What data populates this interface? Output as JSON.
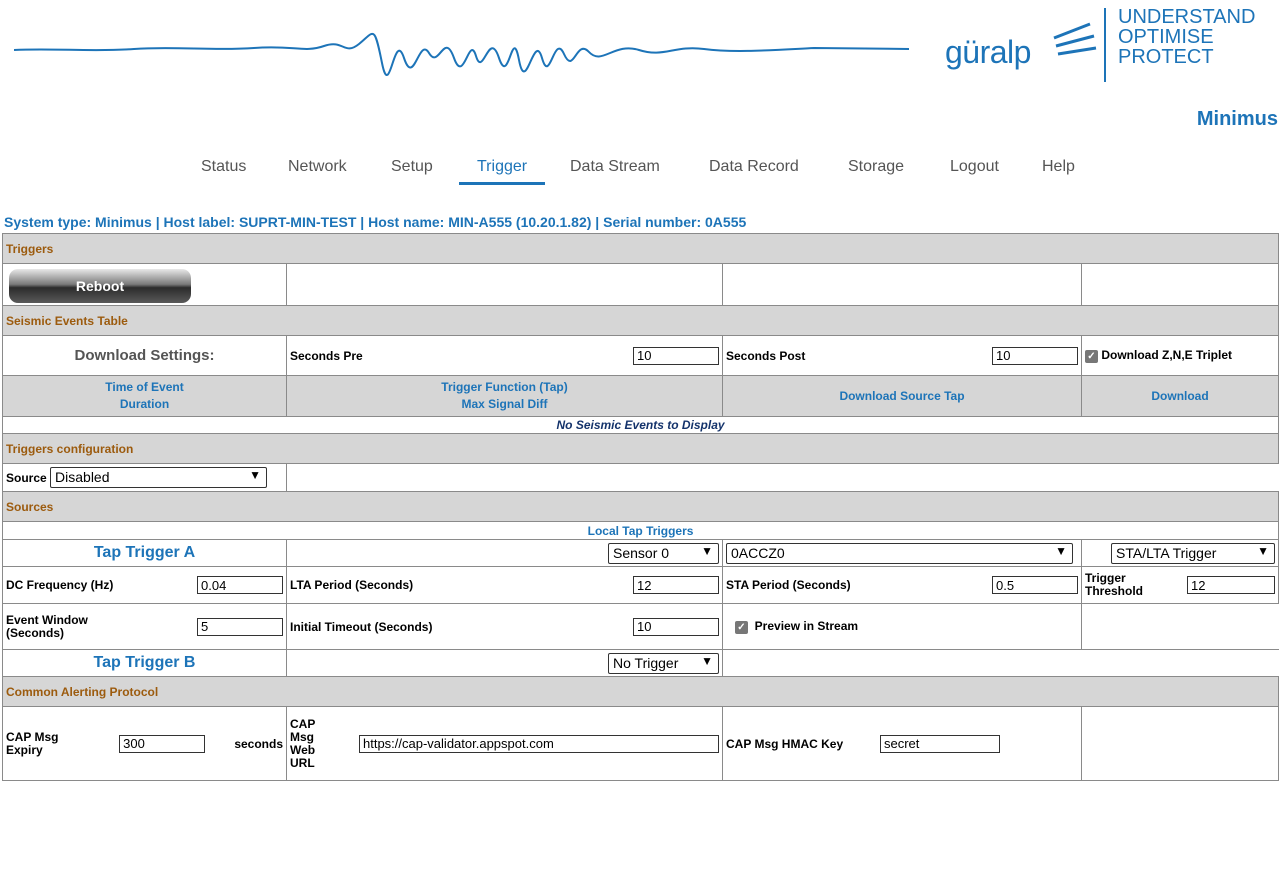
{
  "brand": {
    "logo": "güralp",
    "tagline": [
      "UNDERSTAND",
      "OPTIMISE",
      "PROTECT"
    ],
    "product": "Minimus"
  },
  "nav": {
    "items": [
      "Status",
      "Network",
      "Setup",
      "Trigger",
      "Data Stream",
      "Data Record",
      "Storage",
      "Logout",
      "Help"
    ],
    "active": "Trigger"
  },
  "system_info": "System type: Minimus | Host label: SUPRT-MIN-TEST | Host name: MIN-A555 (10.20.1.82) | Serial number: 0A555",
  "triggers": {
    "title": "Triggers",
    "reboot_label": "Reboot"
  },
  "events": {
    "title": "Seismic Events Table",
    "download_settings_label": "Download Settings:",
    "seconds_pre_label": "Seconds Pre",
    "seconds_pre_value": "10",
    "seconds_post_label": "Seconds Post",
    "seconds_post_value": "10",
    "download_triplet_label": "Download Z,N,E Triplet",
    "columns": [
      "Time of Event",
      "Duration",
      "Trigger Function (Tap)",
      "Max Signal Diff",
      "Download Source Tap",
      "Download"
    ],
    "empty_message": "No Seismic Events to Display"
  },
  "config": {
    "title": "Triggers configuration",
    "source_label": "Source",
    "source_value": "Disabled"
  },
  "sources": {
    "title": "Sources",
    "local_tap_triggers": "Local Tap Triggers",
    "tap_a": {
      "label": "Tap Trigger A",
      "sensor": "Sensor 0",
      "channel": "0ACCZ0",
      "type": "STA/LTA Trigger",
      "dc_freq_label": "DC Frequency (Hz)",
      "dc_freq_value": "0.04",
      "lta_label": "LTA Period (Seconds)",
      "lta_value": "12",
      "sta_label": "STA Period (Seconds)",
      "sta_value": "0.5",
      "threshold_label": "Trigger Threshold",
      "threshold_value": "12",
      "event_window_label": "Event Window (Seconds)",
      "event_window_value": "5",
      "initial_timeout_label": "Initial Timeout (Seconds)",
      "initial_timeout_value": "10",
      "preview_label": "Preview in Stream"
    },
    "tap_b": {
      "label": "Tap Trigger B",
      "type": "No Trigger"
    }
  },
  "cap": {
    "title": "Common Alerting Protocol",
    "expiry_label": "CAP Msg Expiry",
    "expiry_value": "300",
    "expiry_unit": "seconds",
    "url_label": "CAP Msg Web URL",
    "url_value": "https://cap-validator.appspot.com",
    "hmac_label": "CAP Msg HMAC Key",
    "hmac_value": "secret"
  },
  "colors": {
    "brand_blue": "#1d74b8",
    "section_brown": "#9c5b0e",
    "header_grey": "#d6d6d6"
  }
}
